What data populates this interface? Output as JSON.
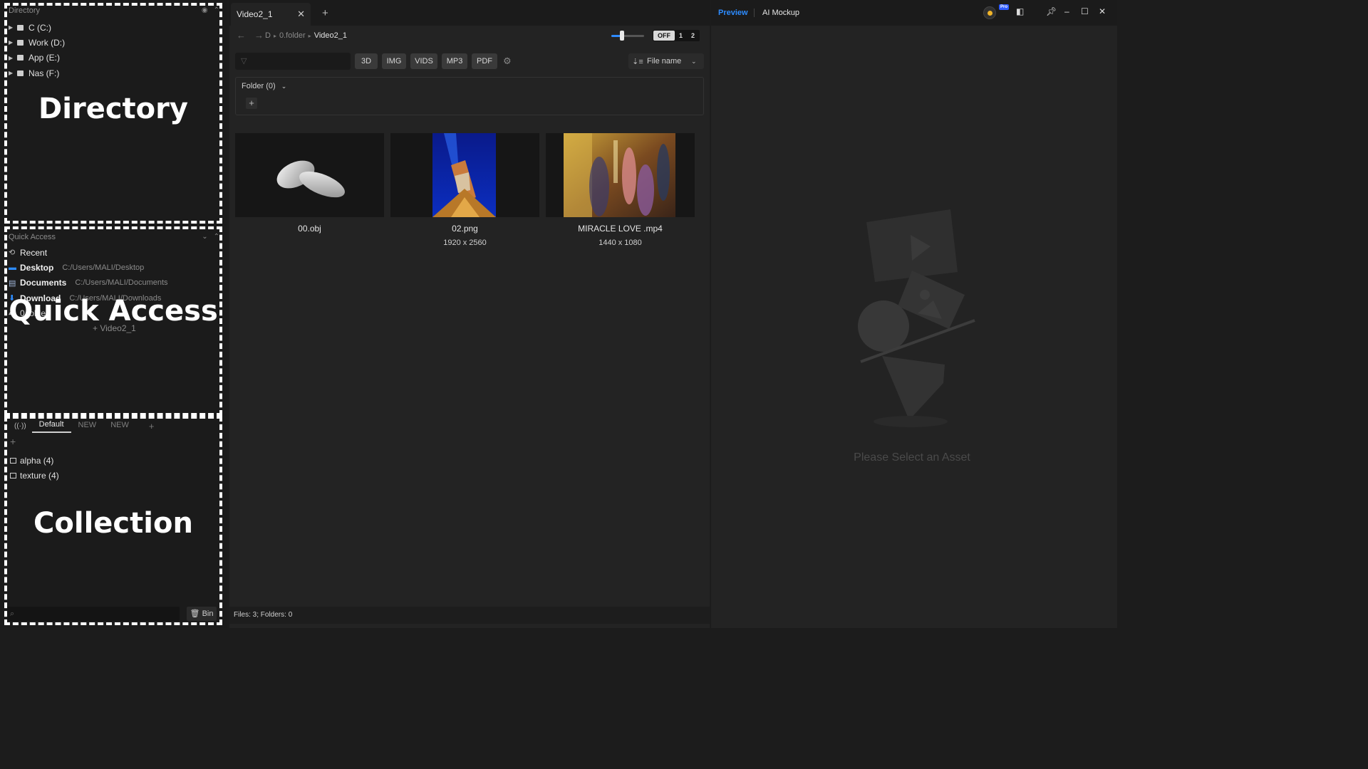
{
  "directory": {
    "header": "Directory",
    "overlay_label": "Directory",
    "drives": [
      {
        "label": "C (C:)"
      },
      {
        "label": "Work (D:)"
      },
      {
        "label": "App (E:)"
      },
      {
        "label": "Nas (F:)"
      }
    ]
  },
  "quick_access": {
    "header": "Quick Access",
    "overlay_label": "Quick Access",
    "items": [
      {
        "name": "Recent",
        "path": "",
        "icon": "history-icon"
      },
      {
        "name": "Desktop",
        "path": "C:/Users/MALI/Desktop",
        "icon": "desktop-icon"
      },
      {
        "name": "Documents",
        "path": "C:/Users/MALI/Documents",
        "icon": "document-icon"
      },
      {
        "name": "Download",
        "path": "C:/Users/MALI/Downloads",
        "icon": "download-icon"
      },
      {
        "name": "0.folder",
        "path": "",
        "icon": "folder-icon"
      }
    ],
    "sub_item": "+ Video2_1"
  },
  "collection": {
    "overlay_label": "Collection",
    "tabs": [
      "Default",
      "NEW",
      "NEW"
    ],
    "items": [
      {
        "label": "alpha (4)"
      },
      {
        "label": "texture (4)"
      }
    ],
    "bin_label": "Bin"
  },
  "center": {
    "tab_title": "Video2_1",
    "breadcrumb": [
      "D",
      "0.folder",
      "Video2_1"
    ],
    "view_toggle": [
      "OFF",
      "1",
      "2"
    ],
    "filters": [
      "3D",
      "IMG",
      "VIDS",
      "MP3",
      "PDF"
    ],
    "sort_label": "File name",
    "folder_header": "Folder (0)",
    "assets": [
      {
        "name": "00.obj",
        "dims": ""
      },
      {
        "name": "02.png",
        "dims": "1920 x 2560"
      },
      {
        "name": "MIRACLE LOVE .mp4",
        "dims": "1440 x 1080"
      }
    ],
    "status": "Files: 3; Folders: 0"
  },
  "right": {
    "tabs": {
      "preview": "Preview",
      "mockup": "AI Mockup"
    },
    "pro_badge": "Pro",
    "empty_text": "Please Select an Asset"
  },
  "colors": {
    "accent": "#2d8cff",
    "background": "#232323",
    "panel": "#1b1b1b"
  }
}
